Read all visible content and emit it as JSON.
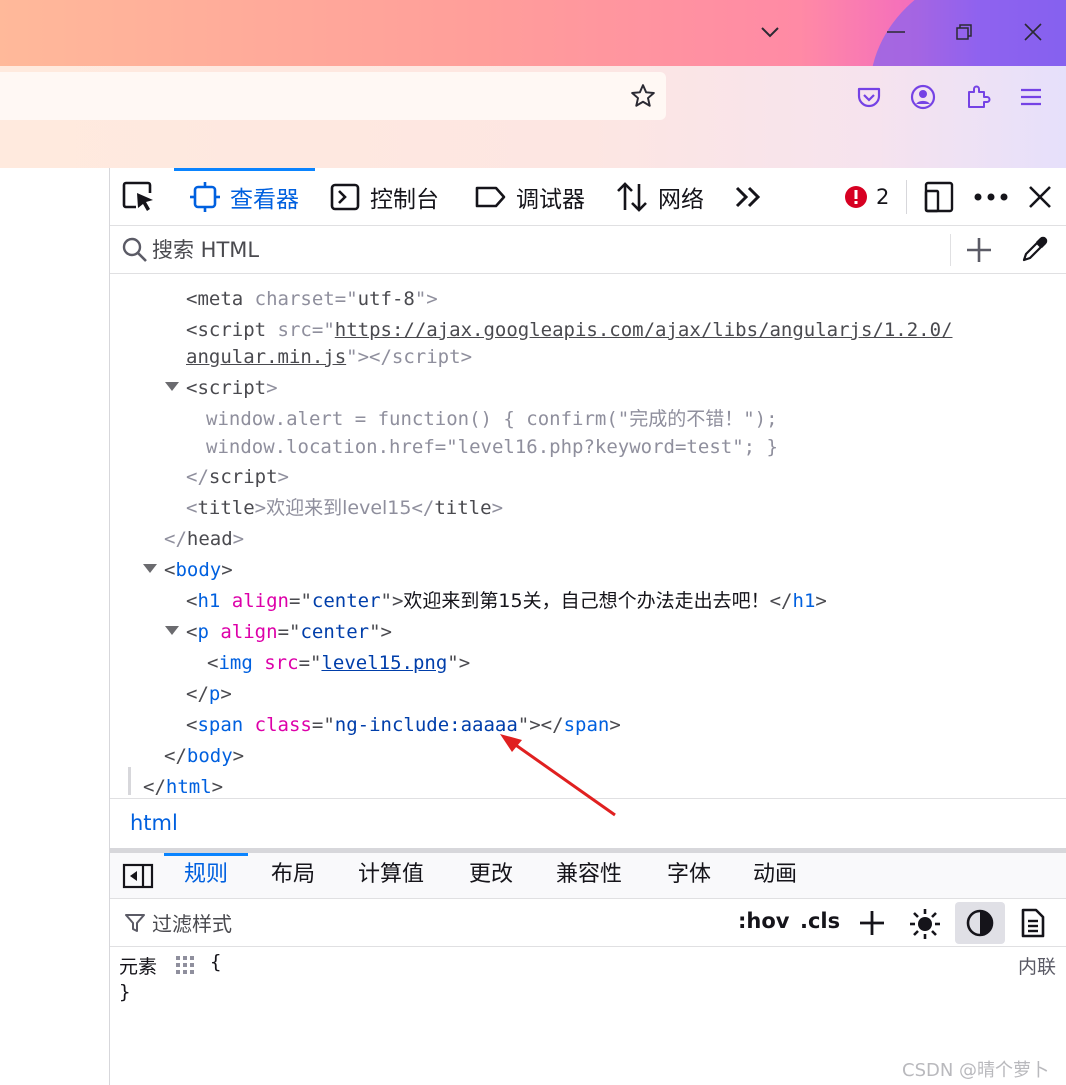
{
  "browser": {
    "window_controls": {
      "list_all_tabs": "chevron-down",
      "minimize": "minimize",
      "restore": "restore",
      "close": "close"
    },
    "toolbar_icons": [
      "star-icon",
      "pocket-icon",
      "account-icon",
      "extensions-icon",
      "menu-icon"
    ]
  },
  "devtools": {
    "tabs": [
      {
        "label": "查看器",
        "icon": "inspector-icon",
        "active": true
      },
      {
        "label": "控制台",
        "icon": "console-icon",
        "active": false
      },
      {
        "label": "调试器",
        "icon": "debugger-icon",
        "active": false
      },
      {
        "label": "网络",
        "icon": "network-icon",
        "active": false
      }
    ],
    "error_count": "2",
    "search": {
      "placeholder": "搜索 HTML"
    },
    "markup": {
      "l1": {
        "open": "<",
        "tag": "meta",
        "attr": "charset",
        "eq": "=\"",
        "val": "utf-8",
        "close": "\">"
      },
      "l2": {
        "open": "<",
        "tag": "script",
        "attr": "src",
        "eq": "=\"",
        "url1": "https://ajax.googleapis.com/ajax/libs/angularjs/1.2.0/",
        "url2": "angular.min.js",
        "close": "\"></",
        "tag2": "script",
        "end": ">"
      },
      "l3": {
        "open": "<",
        "tag": "script",
        "close": ">"
      },
      "l4": "window.alert = function() { confirm(\"完成的不错！\");",
      "l5": "window.location.href=\"level16.php?keyword=test\"; }",
      "l6": {
        "open": "</",
        "tag": "script",
        "close": ">"
      },
      "l7": {
        "open": "<",
        "tag": "title",
        "close": ">",
        "text": "欢迎来到level15",
        "open2": "</",
        "tag2": "title",
        "close2": ">"
      },
      "l8": {
        "open": "</",
        "tag": "head",
        "close": ">"
      },
      "l9": {
        "open": "<",
        "tag": "body",
        "close": ">"
      },
      "l10": {
        "open": "<",
        "tag": "h1",
        "attr": "align",
        "eq": "=\"",
        "val": "center",
        "close": "\">",
        "text": "欢迎来到第15关，自己想个办法走出去吧！",
        "open2": "</",
        "tag2": "h1",
        "close2": ">"
      },
      "l11": {
        "open": "<",
        "tag": "p",
        "attr": "align",
        "eq": "=\"",
        "val": "center",
        "close": "\">"
      },
      "l12": {
        "open": "<",
        "tag": "img",
        "attr": "src",
        "eq": "=\"",
        "val": "level15.png",
        "close": "\">"
      },
      "l13": {
        "open": "</",
        "tag": "p",
        "close": ">"
      },
      "l14": {
        "open": "<",
        "tag": "span",
        "attr": "class",
        "eq": "=\"",
        "val": "ng-include:aaaaa",
        "close": "\"></",
        "tag2": "span",
        "end": ">"
      },
      "l15": {
        "open": "</",
        "tag": "body",
        "close": ">"
      },
      "l16": {
        "open": "</",
        "tag": "html",
        "close": ">"
      }
    },
    "breadcrumb": "html",
    "rules_tabs": [
      "规则",
      "布局",
      "计算值",
      "更改",
      "兼容性",
      "字体",
      "动画"
    ],
    "filter": {
      "placeholder": "过滤样式"
    },
    "pseudo_buttons": {
      "hov": ":hov",
      "cls": ".cls"
    },
    "rule": {
      "selector": "元素",
      "open_brace": "{",
      "close_brace": "}",
      "source": "内联"
    }
  },
  "watermark": "CSDN @晴个萝卜",
  "colors": {
    "accent": "#0060df",
    "tag": "#0060df",
    "attr": "#dd00a9",
    "value": "#003eaa",
    "error": "#d70022",
    "annotation_arrow": "#e02020"
  }
}
